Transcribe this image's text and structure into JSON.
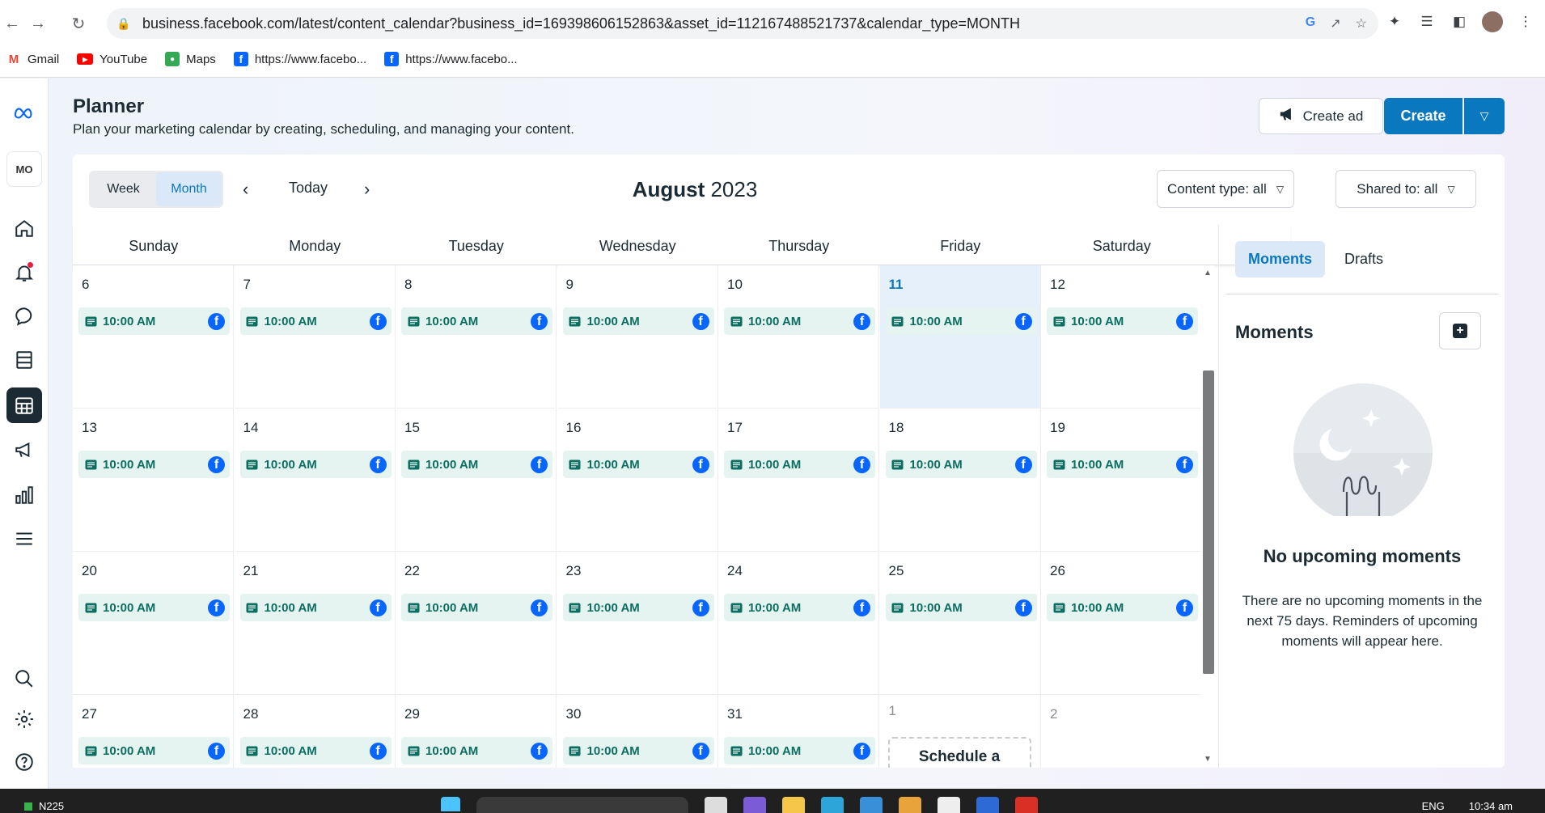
{
  "browser": {
    "url": "business.facebook.com/latest/content_calendar?business_id=169398606152863&asset_id=112167488521737&calendar_type=MONTH",
    "bookmarks": [
      {
        "label": "Gmail",
        "icon": "gmail-icon"
      },
      {
        "label": "YouTube",
        "icon": "youtube-icon"
      },
      {
        "label": "Maps",
        "icon": "maps-icon"
      },
      {
        "label": "https://www.facebo...",
        "icon": "facebook-icon"
      },
      {
        "label": "https://www.facebo...",
        "icon": "facebook-icon"
      }
    ]
  },
  "header": {
    "title": "Planner",
    "subtitle": "Plan your marketing calendar by creating, scheduling, and managing your content.",
    "create_ad_label": "Create ad",
    "create_label": "Create"
  },
  "sidebar": {
    "brand": "MO",
    "items": [
      "home-icon",
      "notifications-icon",
      "inbox-icon",
      "content-icon",
      "planner-icon",
      "ads-icon",
      "insights-icon",
      "menu-icon",
      "search-icon",
      "settings-icon",
      "help-icon"
    ],
    "active": "planner-icon"
  },
  "calendar": {
    "view_week": "Week",
    "view_month": "Month",
    "today_label": "Today",
    "month_name": "August",
    "year": "2023",
    "content_type_filter": "Content type: all",
    "shared_to_filter": "Shared to: all",
    "weekdays": [
      "Sunday",
      "Monday",
      "Tuesday",
      "Wednesday",
      "Thursday",
      "Friday",
      "Saturday"
    ],
    "post_time": "10:00 AM",
    "schedule_label": "Schedule a",
    "weeks": [
      [
        {
          "d": "6",
          "post": true
        },
        {
          "d": "7",
          "post": true
        },
        {
          "d": "8",
          "post": true
        },
        {
          "d": "9",
          "post": true
        },
        {
          "d": "10",
          "post": true
        },
        {
          "d": "11",
          "post": true,
          "today": true
        },
        {
          "d": "12",
          "post": true
        }
      ],
      [
        {
          "d": "13",
          "post": true
        },
        {
          "d": "14",
          "post": true
        },
        {
          "d": "15",
          "post": true
        },
        {
          "d": "16",
          "post": true
        },
        {
          "d": "17",
          "post": true
        },
        {
          "d": "18",
          "post": true
        },
        {
          "d": "19",
          "post": true
        }
      ],
      [
        {
          "d": "20",
          "post": true
        },
        {
          "d": "21",
          "post": true
        },
        {
          "d": "22",
          "post": true
        },
        {
          "d": "23",
          "post": true
        },
        {
          "d": "24",
          "post": true
        },
        {
          "d": "25",
          "post": true
        },
        {
          "d": "26",
          "post": true
        }
      ],
      [
        {
          "d": "27",
          "post": true
        },
        {
          "d": "28",
          "post": true
        },
        {
          "d": "29",
          "post": true
        },
        {
          "d": "30",
          "post": true
        },
        {
          "d": "31",
          "post": true
        },
        {
          "d": "1",
          "post": false,
          "other": true,
          "schedule": true
        },
        {
          "d": "2",
          "post": false,
          "other": true
        }
      ]
    ]
  },
  "moments": {
    "tab_moments": "Moments",
    "tab_drafts": "Drafts",
    "title": "Moments",
    "empty_title": "No upcoming moments",
    "empty_text": "There are no upcoming moments in the next 75 days. Reminders of upcoming moments will appear here."
  },
  "taskbar": {
    "left_label": "N225",
    "lang": "ENG",
    "time": "10:34 am"
  },
  "colors": {
    "accent": "#0a78be",
    "post_bg": "#e6f4f1",
    "post_text": "#0b6e60",
    "facebook": "#0866ff"
  }
}
